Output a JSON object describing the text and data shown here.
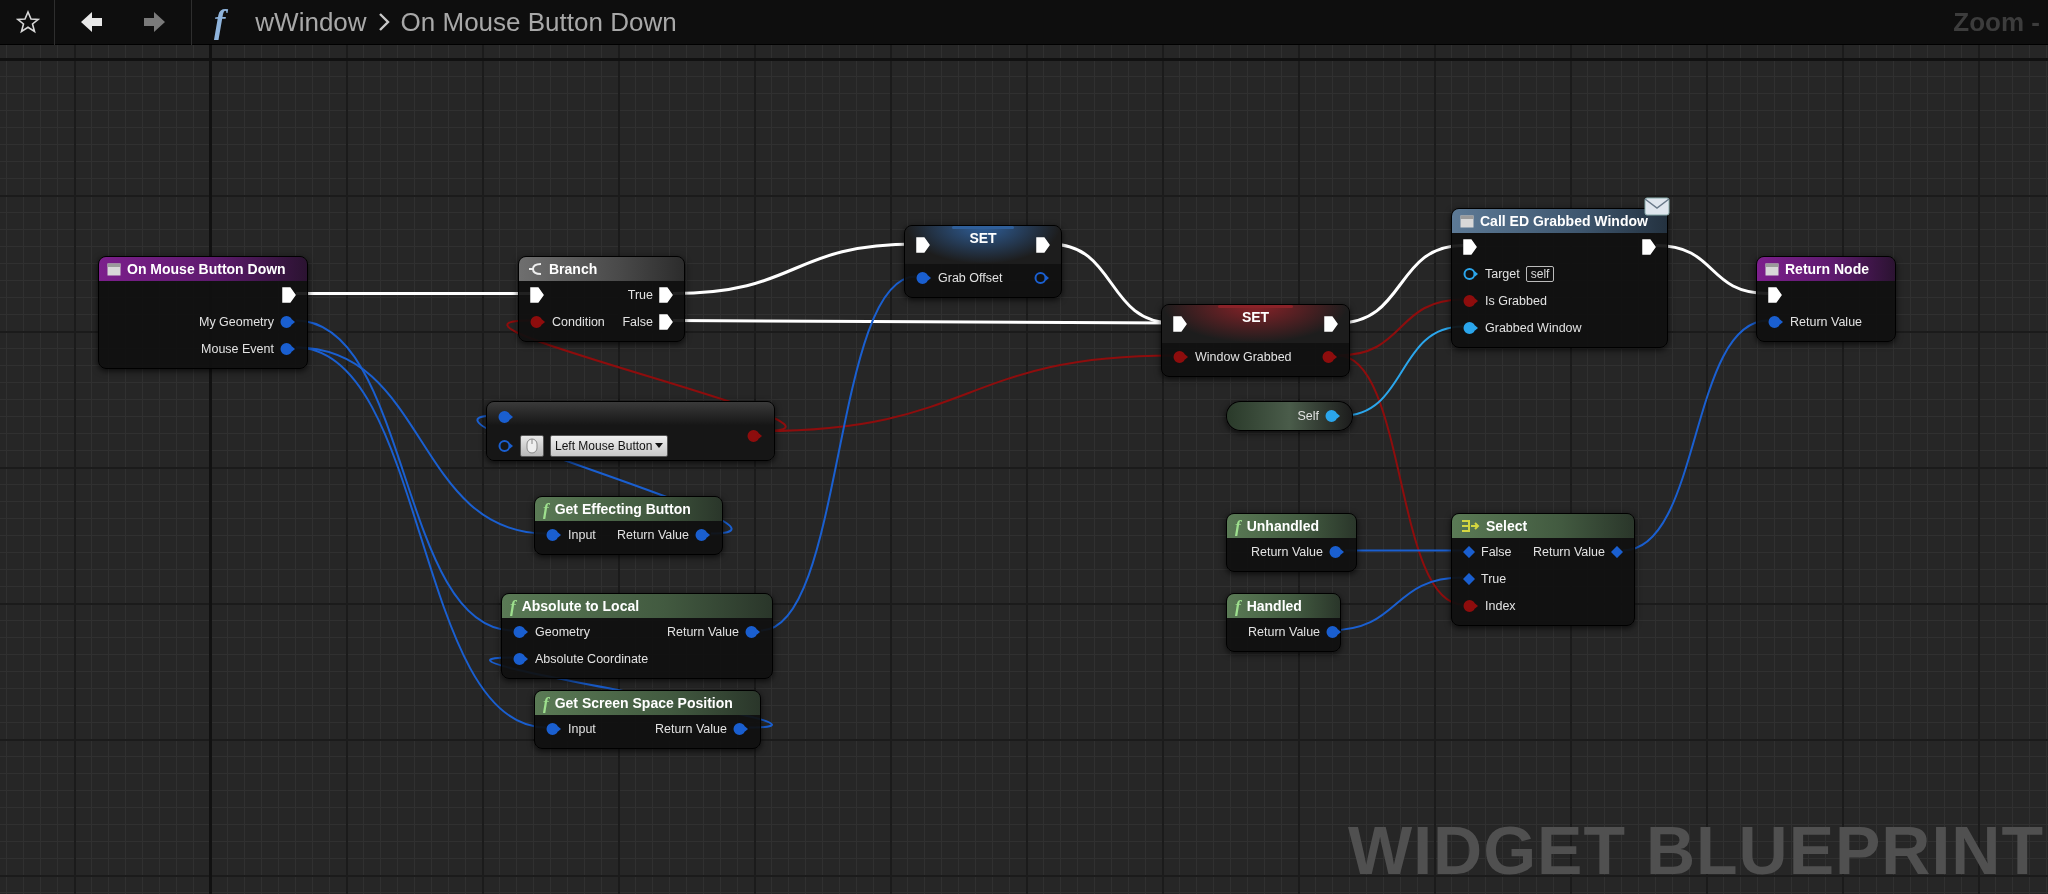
{
  "toolbar": {
    "back": {
      "disabled": false
    },
    "forward": {
      "disabled": true
    },
    "function_glyph": "f",
    "breadcrumb": [
      {
        "label": "wWindow"
      },
      {
        "label": "On Mouse Button Down"
      }
    ],
    "zoom": "Zoom -"
  },
  "nodes": [
    {
      "kind": "event",
      "title": "On Mouse Button Down",
      "rows": [
        {
          "out": {
            "kind": "exec",
            "color": "#ffffff",
            "filled": true
          }
        },
        {
          "out": {
            "kind": "data",
            "label": "My Geometry",
            "color": "#1a5fd0",
            "filled": true
          }
        },
        {
          "out": {
            "kind": "data",
            "label": "Mouse Event",
            "color": "#1a5fd0",
            "filled": true
          }
        }
      ]
    },
    {
      "kind": "flow",
      "title": "Branch",
      "rows": [
        {
          "in": {
            "kind": "exec",
            "color": "#ffffff",
            "filled": true
          },
          "out": {
            "kind": "exec",
            "label": "True",
            "color": "#ffffff",
            "filled": true
          }
        },
        {
          "in": {
            "kind": "data",
            "label": "Condition",
            "color": "#8e0d0d",
            "filled": true
          },
          "out": {
            "kind": "exec",
            "label": "False",
            "color": "#ffffff",
            "filled": true
          }
        }
      ]
    },
    {
      "kind": "set",
      "title": "SET",
      "color": "#2f5f9a",
      "rows": [
        {
          "in": {
            "kind": "exec",
            "color": "#ffffff",
            "filled": true
          },
          "out": {
            "kind": "exec",
            "color": "#ffffff",
            "filled": true
          }
        },
        {
          "in": {
            "kind": "data",
            "label": "Grab Offset",
            "color": "#1a5fd0",
            "filled": true
          },
          "out": {
            "kind": "data",
            "color": "#1a5fd0",
            "filled": false
          }
        }
      ]
    },
    {
      "kind": "key",
      "rows": [
        {
          "in": {
            "kind": "data",
            "color": "#1a5fd0",
            "filled": true
          }
        },
        {
          "in": {
            "kind": "data",
            "color": "#1a5fd0",
            "filled": false
          },
          "value": "Left Mouse Button"
        }
      ],
      "output": {
        "kind": "data",
        "color": "#8e0d0d",
        "filled": true
      }
    },
    {
      "kind": "function",
      "glyph": "f",
      "title": "Get Effecting Button",
      "rows": [
        {
          "in": {
            "kind": "data",
            "label": "Input",
            "color": "#1a5fd0",
            "filled": true
          },
          "out": {
            "kind": "data",
            "label": "Return Value",
            "color": "#1a5fd0",
            "filled": true
          }
        }
      ]
    },
    {
      "kind": "function",
      "glyph": "f",
      "title": "Absolute to Local",
      "rows": [
        {
          "in": {
            "kind": "data",
            "label": "Geometry",
            "color": "#1a5fd0",
            "filled": true
          },
          "out": {
            "kind": "data",
            "label": "Return Value",
            "color": "#1a5fd0",
            "filled": true
          }
        },
        {
          "in": {
            "kind": "data",
            "label": "Absolute Coordinate",
            "color": "#1a5fd0",
            "filled": true
          }
        }
      ]
    },
    {
      "kind": "function",
      "glyph": "f",
      "title": "Get Screen Space Position",
      "rows": [
        {
          "in": {
            "kind": "data",
            "label": "Input",
            "color": "#1a5fd0",
            "filled": true
          },
          "out": {
            "kind": "data",
            "label": "Return Value",
            "color": "#1a5fd0",
            "filled": true
          }
        }
      ]
    },
    {
      "kind": "set",
      "title": "SET",
      "color": "#8a2228",
      "rows": [
        {
          "in": {
            "kind": "exec",
            "color": "#ffffff",
            "filled": true
          },
          "out": {
            "kind": "exec",
            "color": "#ffffff",
            "filled": true
          }
        },
        {
          "in": {
            "kind": "data",
            "label": "Window Grabbed",
            "color": "#8e0d0d",
            "filled": true
          },
          "out": {
            "kind": "data",
            "color": "#8e0d0d",
            "filled": true
          }
        }
      ]
    },
    {
      "kind": "self",
      "rows": [
        {
          "out": {
            "kind": "data",
            "label": "Self",
            "color": "#2ba6ec",
            "filled": true
          }
        }
      ]
    },
    {
      "kind": "call",
      "title": "Call ED Grabbed Window",
      "message": true,
      "rows": [
        {
          "in": {
            "kind": "exec",
            "color": "#ffffff",
            "filled": true
          },
          "out": {
            "kind": "exec",
            "color": "#ffffff",
            "filled": true
          }
        },
        {
          "in": {
            "kind": "data",
            "label": "Target",
            "color": "#2ba6ec",
            "filled": false,
            "default": "self"
          }
        },
        {
          "in": {
            "kind": "data",
            "label": "Is Grabbed",
            "color": "#8e0d0d",
            "filled": true
          }
        },
        {
          "in": {
            "kind": "data",
            "label": "Grabbed Window",
            "color": "#2ba6ec",
            "filled": true
          }
        }
      ]
    },
    {
      "kind": "function",
      "glyph": "f",
      "title": "Unhandled",
      "rows": [
        {
          "out": {
            "kind": "data",
            "label": "Return Value",
            "color": "#1a5fd0",
            "filled": true
          }
        }
      ]
    },
    {
      "kind": "function",
      "glyph": "f",
      "title": "Handled",
      "rows": [
        {
          "out": {
            "kind": "data",
            "label": "Return Value",
            "color": "#1a5fd0",
            "filled": true
          }
        }
      ]
    },
    {
      "kind": "select",
      "title": "Select",
      "rows": [
        {
          "in": {
            "kind": "diamond",
            "label": "False",
            "color": "#1a5fd0",
            "filled": true
          },
          "out": {
            "kind": "diamond",
            "label": "Return Value",
            "color": "#1a5fd0",
            "filled": true
          }
        },
        {
          "in": {
            "kind": "diamond",
            "label": "True",
            "color": "#1a5fd0",
            "filled": true
          }
        },
        {
          "in": {
            "kind": "data",
            "label": "Index",
            "color": "#8e0d0d",
            "filled": true
          }
        }
      ]
    },
    {
      "kind": "event",
      "title": "Return Node",
      "rows": [
        {
          "in": {
            "kind": "exec",
            "color": "#ffffff",
            "filled": true
          }
        },
        {
          "in": {
            "kind": "data",
            "label": "Return Value",
            "color": "#1a5fd0",
            "filled": true
          }
        }
      ]
    }
  ],
  "graph_type": "WIDGET BLUEPRINT"
}
